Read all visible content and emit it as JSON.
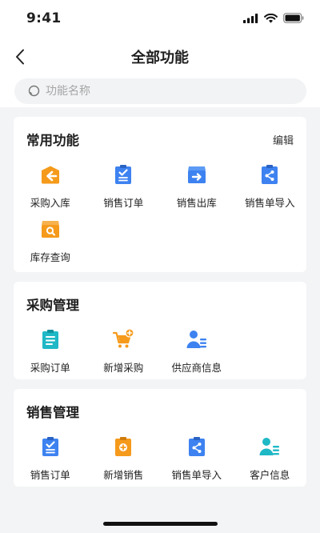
{
  "status": {
    "time": "9:41"
  },
  "nav": {
    "title": "全部功能"
  },
  "search": {
    "placeholder": "功能名称"
  },
  "sections": [
    {
      "title": "常用功能",
      "action": "编辑",
      "items": [
        {
          "label": "采购入库",
          "icon": "warehouse-in-icon",
          "color": "#f59a1b"
        },
        {
          "label": "销售订单",
          "icon": "clipboard-check-icon",
          "color": "#3d82f0"
        },
        {
          "label": "销售出库",
          "icon": "box-out-icon",
          "color": "#3d82f0"
        },
        {
          "label": "销售单导入",
          "icon": "share-clipboard-icon",
          "color": "#3d82f0"
        },
        {
          "label": "库存查询",
          "icon": "box-search-icon",
          "color": "#f59a1b"
        }
      ]
    },
    {
      "title": "采购管理",
      "items": [
        {
          "label": "采购订单",
          "icon": "clipboard-list-icon",
          "color": "#1fb8c6"
        },
        {
          "label": "新增采购",
          "icon": "cart-add-icon",
          "color": "#f59a1b"
        },
        {
          "label": "供应商信息",
          "icon": "supplier-icon",
          "color": "#3d82f0"
        }
      ]
    },
    {
      "title": "销售管理",
      "items": [
        {
          "label": "销售订单",
          "icon": "clipboard-check-icon",
          "color": "#3d82f0"
        },
        {
          "label": "新增销售",
          "icon": "clipboard-add-icon",
          "color": "#f59a1b"
        },
        {
          "label": "销售单导入",
          "icon": "share-clipboard-icon",
          "color": "#3d82f0"
        },
        {
          "label": "客户信息",
          "icon": "customer-icon",
          "color": "#1fb8c6"
        }
      ]
    }
  ]
}
